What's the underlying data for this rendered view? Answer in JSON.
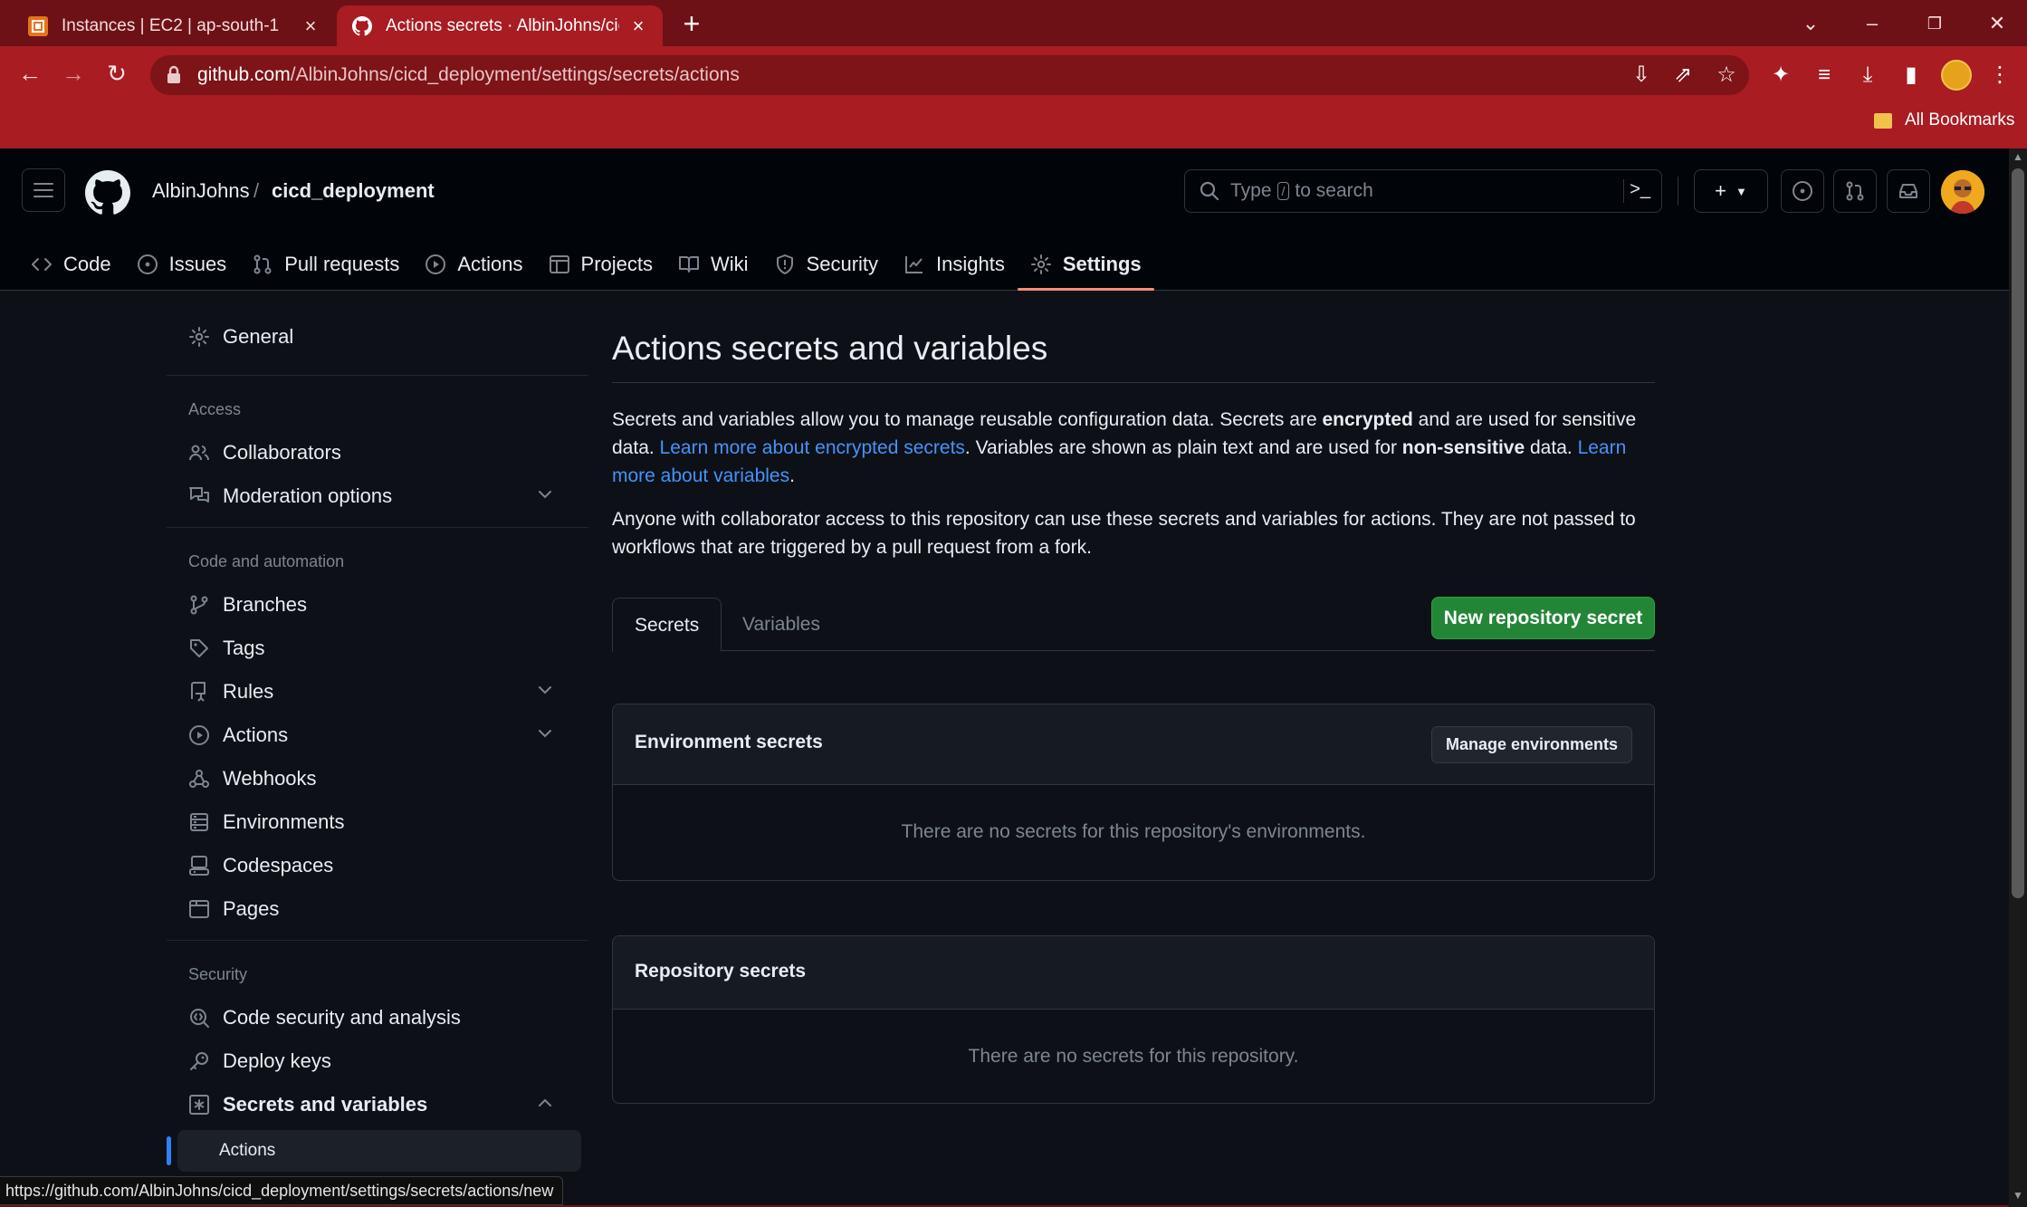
{
  "browser": {
    "tabs": [
      {
        "title": "Instances | EC2 | ap-south-1",
        "icon": "aws-icon"
      },
      {
        "title": "Actions secrets · AlbinJohns/cicd_deployment",
        "icon": "github-icon"
      }
    ],
    "url_host": "github.com",
    "url_path": "/AlbinJohns/cicd_deployment/settings/secrets/actions",
    "bookmarks_label": "All Bookmarks",
    "status_url": "https://github.com/AlbinJohns/cicd_deployment/settings/secrets/actions/new",
    "colors": {
      "frame": "#6e1116",
      "toolbar": "#a81c22"
    }
  },
  "header": {
    "owner": "AlbinJohns",
    "separator": "/",
    "repo": "cicd_deployment",
    "search_prefix": "Type",
    "search_key": "/",
    "search_suffix": "to search"
  },
  "repo_nav": [
    {
      "label": "Code",
      "icon": "code-icon"
    },
    {
      "label": "Issues",
      "icon": "issue-icon"
    },
    {
      "label": "Pull requests",
      "icon": "pull-request-icon"
    },
    {
      "label": "Actions",
      "icon": "play-icon"
    },
    {
      "label": "Projects",
      "icon": "table-icon"
    },
    {
      "label": "Wiki",
      "icon": "book-icon"
    },
    {
      "label": "Security",
      "icon": "shield-icon"
    },
    {
      "label": "Insights",
      "icon": "graph-icon"
    },
    {
      "label": "Settings",
      "icon": "gear-icon",
      "selected": true
    }
  ],
  "sidebar": {
    "general": "General",
    "headings": {
      "access": "Access",
      "code_automation": "Code and automation",
      "security": "Security"
    },
    "items": {
      "collaborators": "Collaborators",
      "moderation": "Moderation options",
      "branches": "Branches",
      "tags": "Tags",
      "rules": "Rules",
      "actions": "Actions",
      "webhooks": "Webhooks",
      "environments": "Environments",
      "codespaces": "Codespaces",
      "pages": "Pages",
      "code_security": "Code security and analysis",
      "deploy_keys": "Deploy keys",
      "secrets_vars": "Secrets and variables",
      "secrets_actions": "Actions"
    }
  },
  "main": {
    "title": "Actions secrets and variables",
    "p1": {
      "t1": "Secrets and variables allow you to manage reusable configuration data. Secrets are ",
      "b1": "encrypted",
      "t2": " and are used for sensitive data. ",
      "link1": "Learn more about encrypted secrets",
      "t3": ". Variables are shown as plain text and are used for ",
      "b2": "non-sensitive",
      "t4": " data. ",
      "link2": "Learn more about variables",
      "t5": "."
    },
    "p2": "Anyone with collaborator access to this repository can use these secrets and variables for actions. They are not passed to workflows that are triggered by a pull request from a fork.",
    "tabs": {
      "secrets": "Secrets",
      "variables": "Variables"
    },
    "new_secret_button": "New repository secret",
    "env_secrets": {
      "title": "Environment secrets",
      "button": "Manage environments",
      "empty": "There are no secrets for this repository's environments."
    },
    "repo_secrets": {
      "title": "Repository secrets",
      "empty": "There are no secrets for this repository."
    },
    "colors": {
      "primary_button": "#238636",
      "link": "#4493f8",
      "selected_tab_underline": "#fd8c73"
    }
  }
}
